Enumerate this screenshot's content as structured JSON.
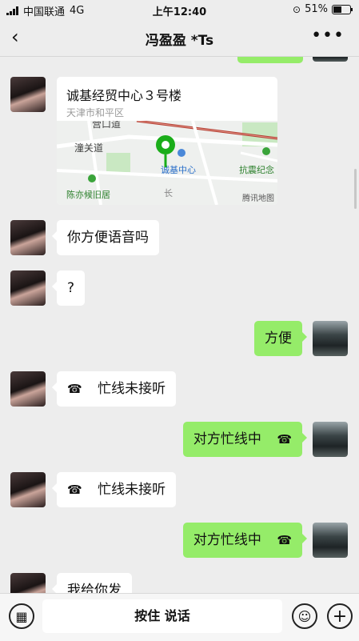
{
  "status": {
    "carrier": "中国联通",
    "network": "4G",
    "time": "上午12:40",
    "battery": "51%",
    "battery_level": 0.51
  },
  "header": {
    "back": "‹",
    "title": "冯盈盈 *Ts",
    "more": "•••"
  },
  "location": {
    "name": "诚基经贸中心３号楼",
    "address": "天津市和平区",
    "labels": {
      "ying": "营口道",
      "tong": "潼关道",
      "chengji": "诚基中心",
      "kangzhen": "抗震纪念",
      "chenyi": "陈亦候旧居",
      "chang": "长",
      "tencent": "腾讯地图"
    }
  },
  "messages": [
    {
      "side": "left",
      "text": "你方便语音吗"
    },
    {
      "side": "left",
      "text": "?"
    },
    {
      "side": "right",
      "text": "方便"
    },
    {
      "side": "left",
      "text": "忙线未接听",
      "icon": "phone-hangup-icon"
    },
    {
      "side": "right",
      "text": "对方忙线中",
      "icon": "phone-hangup-icon"
    },
    {
      "side": "left",
      "text": "忙线未接听",
      "icon": "phone-hangup-icon"
    },
    {
      "side": "right",
      "text": "对方忙线中",
      "icon": "phone-hangup-icon"
    },
    {
      "side": "left",
      "text": "我给你发"
    }
  ],
  "input": {
    "voice_label": "按住 说话"
  },
  "icons": {
    "phone": "☎",
    "keyboard": "▦",
    "emoji": "☺",
    "plus": "+"
  },
  "colors": {
    "bubble_green": "#95ec69",
    "map_pin": "#1aad19"
  }
}
